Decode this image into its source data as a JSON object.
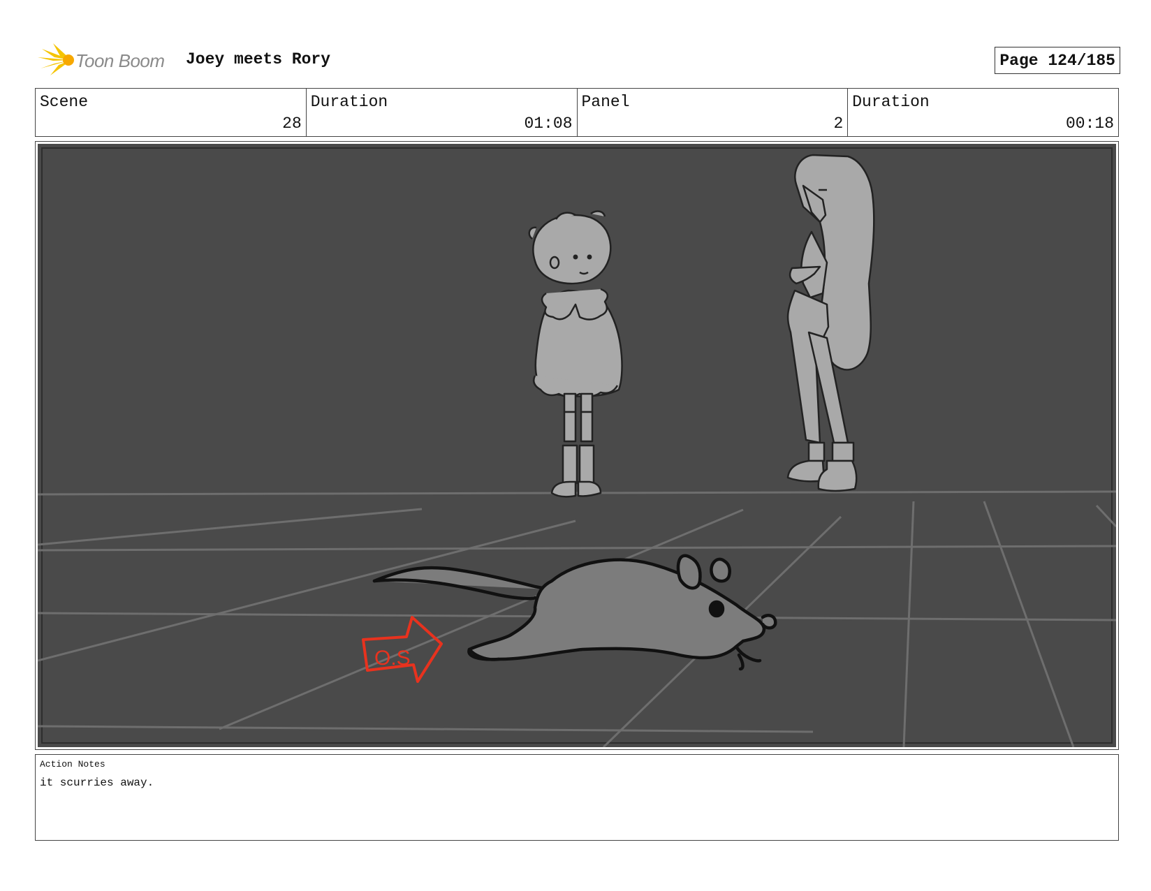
{
  "header": {
    "brand": "Toon Boom",
    "project_title": "Joey meets Rory",
    "page": "Page 124/185"
  },
  "info": {
    "scene_label": "Scene",
    "scene_value": "28",
    "scene_duration_label": "Duration",
    "scene_duration_value": "01:08",
    "panel_label": "Panel",
    "panel_value": "2",
    "panel_duration_label": "Duration",
    "panel_duration_value": "00:18"
  },
  "panel": {
    "annotation": "O.S",
    "colors": {
      "background": "#4a4a4a",
      "grid": "#6e6e6e",
      "figure_fill": "#a9a9a9",
      "mouse_fill": "#7c7c7c",
      "annotation": "#e8321e"
    }
  },
  "notes": {
    "label": "Action Notes",
    "text": "it scurries away."
  }
}
